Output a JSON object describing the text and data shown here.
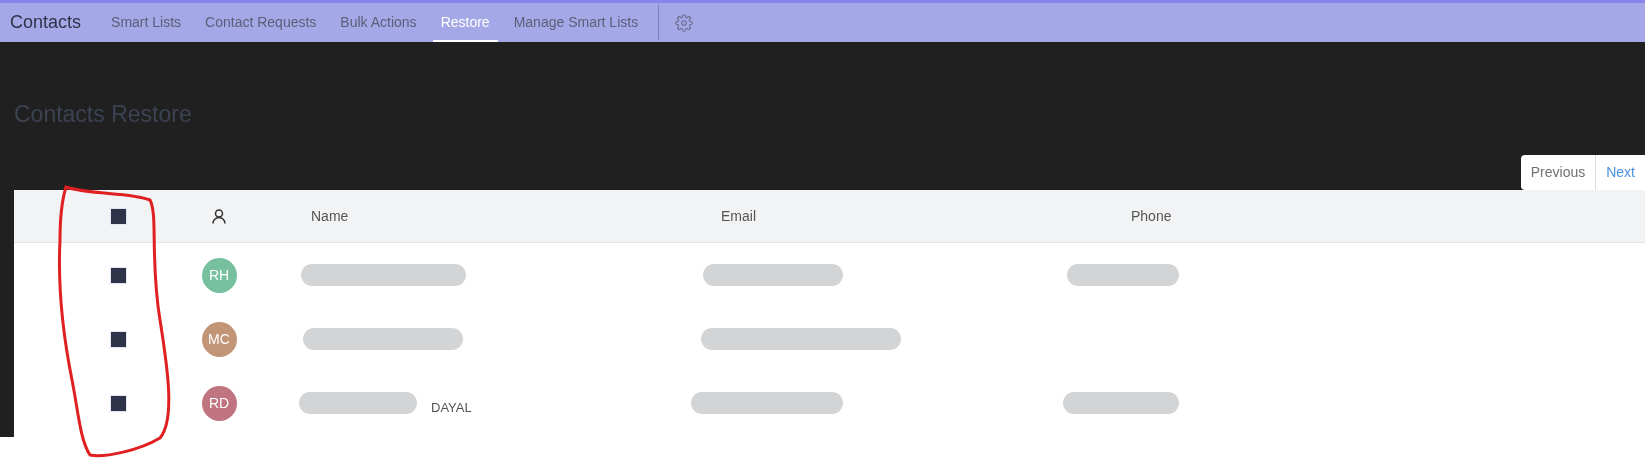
{
  "nav": {
    "title": "Contacts",
    "tabs": [
      {
        "label": "Smart Lists",
        "selected": false
      },
      {
        "label": "Contact Requests",
        "selected": false
      },
      {
        "label": "Bulk Actions",
        "selected": false
      },
      {
        "label": "Restore",
        "selected": true
      },
      {
        "label": "Manage Smart Lists",
        "selected": false
      }
    ]
  },
  "page_title": "Contacts Restore",
  "pagination": [
    "Previous",
    "Next"
  ],
  "table": {
    "select_all_checked": true,
    "columns": [
      "Name",
      "Email",
      "Phone"
    ],
    "rows": [
      {
        "checked": true,
        "initials": "RH",
        "color": "#76c0a0",
        "name": {
          "kind": "redacted"
        },
        "email": {
          "kind": "redacted"
        },
        "phone": {
          "kind": "redacted"
        }
      },
      {
        "checked": true,
        "initials": "MC",
        "color": "#c29576",
        "name": {
          "kind": "redacted"
        },
        "email": {
          "kind": "redacted"
        }
      },
      {
        "checked": true,
        "initials": "RD",
        "color": "#c07480",
        "name": {
          "kind": "redacted",
          "text": "DAYAL"
        },
        "email": {
          "kind": "redacted"
        },
        "phone": {
          "kind": "redacted"
        }
      }
    ]
  },
  "annotation": {
    "kind": "outline",
    "color": "#e02020"
  }
}
